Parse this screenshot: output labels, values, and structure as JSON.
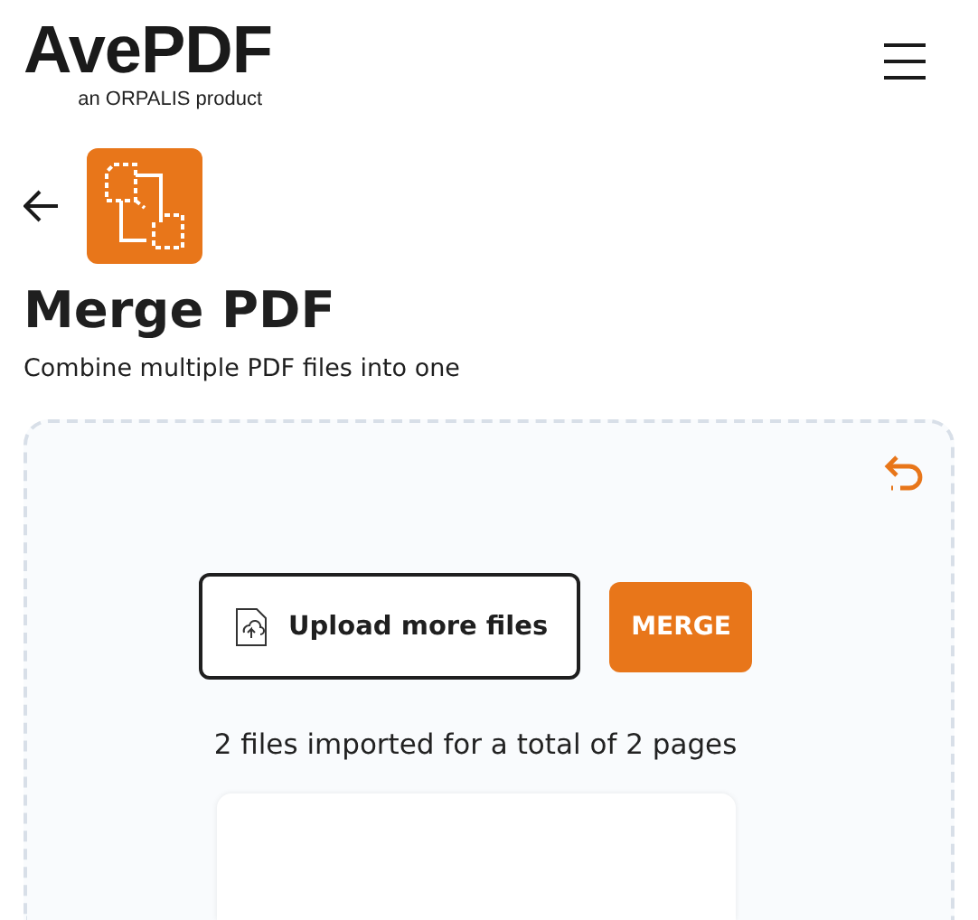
{
  "header": {
    "logo": "AvePDF",
    "tagline": "an ORPALIS product"
  },
  "tool": {
    "title": "Merge PDF",
    "description": "Combine multiple PDF files into one"
  },
  "dropzone": {
    "upload_button": "Upload more files",
    "merge_button": "MERGE",
    "summary": "2 files imported for a total of 2 pages"
  }
}
